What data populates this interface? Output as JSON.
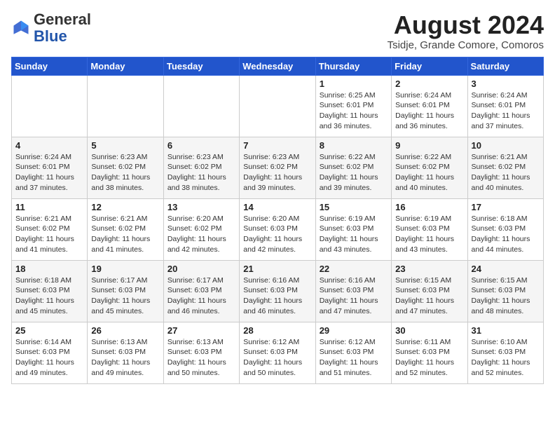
{
  "header": {
    "logo_general": "General",
    "logo_blue": "Blue",
    "title": "August 2024",
    "subtitle": "Tsidje, Grande Comore, Comoros"
  },
  "weekdays": [
    "Sunday",
    "Monday",
    "Tuesday",
    "Wednesday",
    "Thursday",
    "Friday",
    "Saturday"
  ],
  "weeks": [
    [
      {
        "day": "",
        "info": ""
      },
      {
        "day": "",
        "info": ""
      },
      {
        "day": "",
        "info": ""
      },
      {
        "day": "",
        "info": ""
      },
      {
        "day": "1",
        "info": "Sunrise: 6:25 AM\nSunset: 6:01 PM\nDaylight: 11 hours\nand 36 minutes."
      },
      {
        "day": "2",
        "info": "Sunrise: 6:24 AM\nSunset: 6:01 PM\nDaylight: 11 hours\nand 36 minutes."
      },
      {
        "day": "3",
        "info": "Sunrise: 6:24 AM\nSunset: 6:01 PM\nDaylight: 11 hours\nand 37 minutes."
      }
    ],
    [
      {
        "day": "4",
        "info": "Sunrise: 6:24 AM\nSunset: 6:01 PM\nDaylight: 11 hours\nand 37 minutes."
      },
      {
        "day": "5",
        "info": "Sunrise: 6:23 AM\nSunset: 6:02 PM\nDaylight: 11 hours\nand 38 minutes."
      },
      {
        "day": "6",
        "info": "Sunrise: 6:23 AM\nSunset: 6:02 PM\nDaylight: 11 hours\nand 38 minutes."
      },
      {
        "day": "7",
        "info": "Sunrise: 6:23 AM\nSunset: 6:02 PM\nDaylight: 11 hours\nand 39 minutes."
      },
      {
        "day": "8",
        "info": "Sunrise: 6:22 AM\nSunset: 6:02 PM\nDaylight: 11 hours\nand 39 minutes."
      },
      {
        "day": "9",
        "info": "Sunrise: 6:22 AM\nSunset: 6:02 PM\nDaylight: 11 hours\nand 40 minutes."
      },
      {
        "day": "10",
        "info": "Sunrise: 6:21 AM\nSunset: 6:02 PM\nDaylight: 11 hours\nand 40 minutes."
      }
    ],
    [
      {
        "day": "11",
        "info": "Sunrise: 6:21 AM\nSunset: 6:02 PM\nDaylight: 11 hours\nand 41 minutes."
      },
      {
        "day": "12",
        "info": "Sunrise: 6:21 AM\nSunset: 6:02 PM\nDaylight: 11 hours\nand 41 minutes."
      },
      {
        "day": "13",
        "info": "Sunrise: 6:20 AM\nSunset: 6:02 PM\nDaylight: 11 hours\nand 42 minutes."
      },
      {
        "day": "14",
        "info": "Sunrise: 6:20 AM\nSunset: 6:03 PM\nDaylight: 11 hours\nand 42 minutes."
      },
      {
        "day": "15",
        "info": "Sunrise: 6:19 AM\nSunset: 6:03 PM\nDaylight: 11 hours\nand 43 minutes."
      },
      {
        "day": "16",
        "info": "Sunrise: 6:19 AM\nSunset: 6:03 PM\nDaylight: 11 hours\nand 43 minutes."
      },
      {
        "day": "17",
        "info": "Sunrise: 6:18 AM\nSunset: 6:03 PM\nDaylight: 11 hours\nand 44 minutes."
      }
    ],
    [
      {
        "day": "18",
        "info": "Sunrise: 6:18 AM\nSunset: 6:03 PM\nDaylight: 11 hours\nand 45 minutes."
      },
      {
        "day": "19",
        "info": "Sunrise: 6:17 AM\nSunset: 6:03 PM\nDaylight: 11 hours\nand 45 minutes."
      },
      {
        "day": "20",
        "info": "Sunrise: 6:17 AM\nSunset: 6:03 PM\nDaylight: 11 hours\nand 46 minutes."
      },
      {
        "day": "21",
        "info": "Sunrise: 6:16 AM\nSunset: 6:03 PM\nDaylight: 11 hours\nand 46 minutes."
      },
      {
        "day": "22",
        "info": "Sunrise: 6:16 AM\nSunset: 6:03 PM\nDaylight: 11 hours\nand 47 minutes."
      },
      {
        "day": "23",
        "info": "Sunrise: 6:15 AM\nSunset: 6:03 PM\nDaylight: 11 hours\nand 47 minutes."
      },
      {
        "day": "24",
        "info": "Sunrise: 6:15 AM\nSunset: 6:03 PM\nDaylight: 11 hours\nand 48 minutes."
      }
    ],
    [
      {
        "day": "25",
        "info": "Sunrise: 6:14 AM\nSunset: 6:03 PM\nDaylight: 11 hours\nand 49 minutes."
      },
      {
        "day": "26",
        "info": "Sunrise: 6:13 AM\nSunset: 6:03 PM\nDaylight: 11 hours\nand 49 minutes."
      },
      {
        "day": "27",
        "info": "Sunrise: 6:13 AM\nSunset: 6:03 PM\nDaylight: 11 hours\nand 50 minutes."
      },
      {
        "day": "28",
        "info": "Sunrise: 6:12 AM\nSunset: 6:03 PM\nDaylight: 11 hours\nand 50 minutes."
      },
      {
        "day": "29",
        "info": "Sunrise: 6:12 AM\nSunset: 6:03 PM\nDaylight: 11 hours\nand 51 minutes."
      },
      {
        "day": "30",
        "info": "Sunrise: 6:11 AM\nSunset: 6:03 PM\nDaylight: 11 hours\nand 52 minutes."
      },
      {
        "day": "31",
        "info": "Sunrise: 6:10 AM\nSunset: 6:03 PM\nDaylight: 11 hours\nand 52 minutes."
      }
    ]
  ]
}
